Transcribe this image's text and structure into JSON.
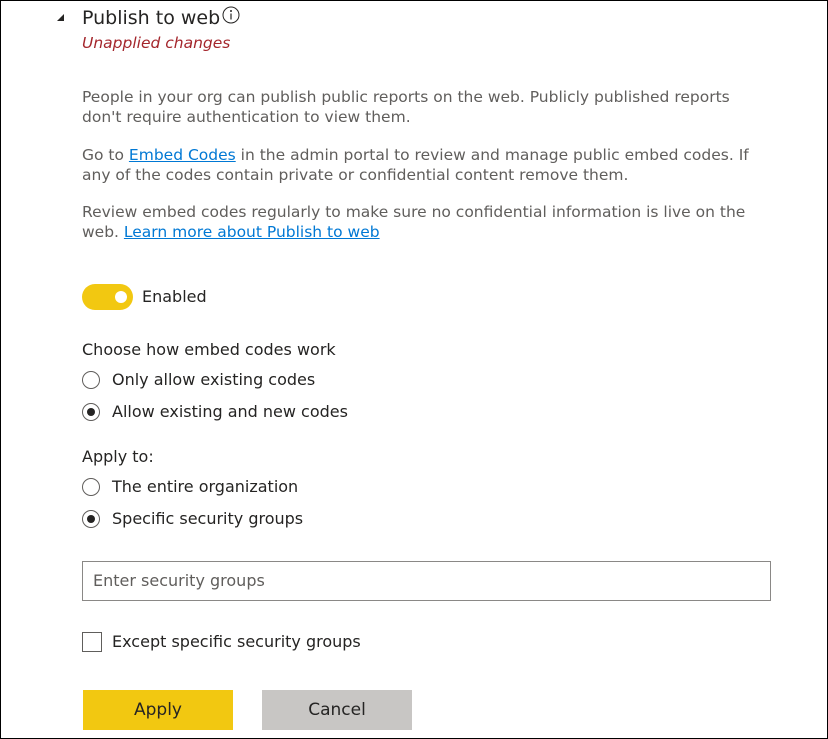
{
  "section": {
    "title": "Publish to web",
    "status": "Unapplied changes"
  },
  "description": {
    "p1": "People in your org can publish public reports on the web. Publicly published reports don't require authentication to view them.",
    "p2_prefix": "Go to ",
    "p2_link": "Embed Codes",
    "p2_suffix": " in the admin portal to review and manage public embed codes. If any of the codes contain private or confidential content remove them.",
    "p3_prefix": "Review embed codes regularly to make sure no confidential information is live on the web. ",
    "p3_link": "Learn more about Publish to web"
  },
  "toggle": {
    "label": "Enabled",
    "on": true,
    "color": "#f2c811"
  },
  "embed_codes": {
    "heading": "Choose how embed codes work",
    "options": [
      "Only allow existing codes",
      "Allow existing and new codes"
    ],
    "selected": "Allow existing and new codes"
  },
  "apply_to": {
    "heading": "Apply to:",
    "options": [
      "The entire organization",
      "Specific security groups"
    ],
    "selected": "Specific security groups"
  },
  "security_groups_input": {
    "placeholder": "Enter security groups",
    "value": ""
  },
  "except_checkbox": {
    "label": "Except specific security groups",
    "checked": false
  },
  "buttons": {
    "apply": "Apply",
    "cancel": "Cancel"
  },
  "colors": {
    "accent": "#f2c811",
    "error": "#a4262c",
    "link": "#0078d4",
    "cancel_bg": "#c8c6c4"
  }
}
